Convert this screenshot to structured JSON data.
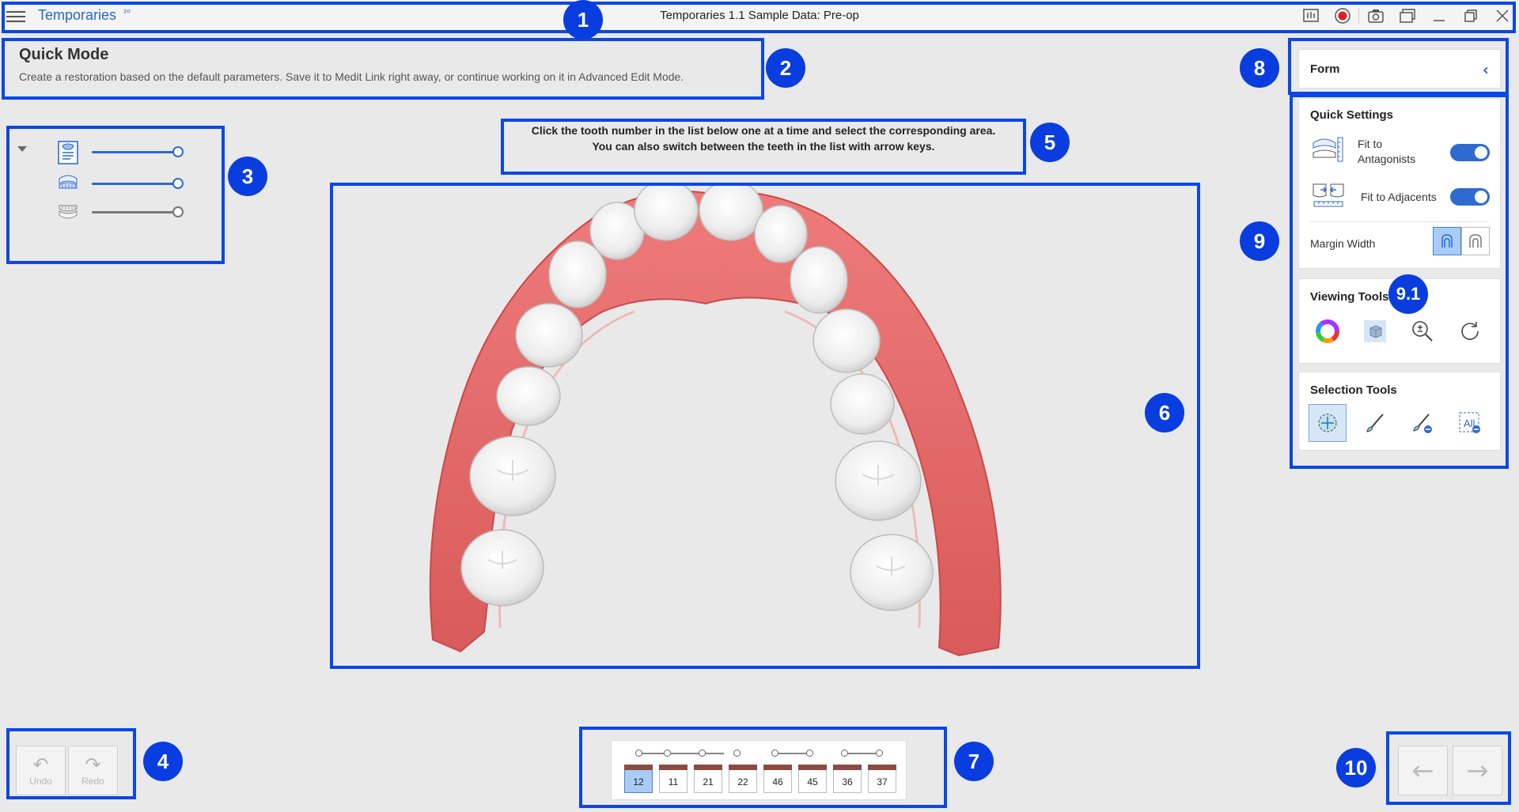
{
  "titlebar": {
    "app_name": "Temporaries",
    "app_name_mark": "²⁰",
    "window_title": "Temporaries 1.1 Sample Data: Pre-op"
  },
  "header": {
    "title": "Quick Mode",
    "description": "Create a restoration based on the default parameters. Save it to Medit Link right away, or continue working on it in Advanced Edit Mode."
  },
  "data_tree": {
    "items": [
      {
        "name": "restoration-data",
        "opacity_pct": 100
      },
      {
        "name": "upper-scan",
        "opacity_pct": 100
      },
      {
        "name": "lower-scan",
        "opacity_pct": 100
      }
    ]
  },
  "instruction": {
    "line1": "Click the tooth number in the list below one at a time and select the corresponding area.",
    "line2": "You can also switch between the teeth in the list with arrow keys."
  },
  "history": {
    "undo_label": "Undo",
    "redo_label": "Redo"
  },
  "tooth_list": {
    "teeth": [
      "12",
      "11",
      "21",
      "22",
      "46",
      "45",
      "36",
      "37"
    ],
    "selected": "12"
  },
  "form_panel": {
    "title": "Form",
    "collapse_icon": "chevron-left-icon"
  },
  "quick_settings": {
    "title": "Quick Settings",
    "fit_antagonists_label": "Fit to Antagonists",
    "fit_antagonists_on": true,
    "fit_adjacents_label": "Fit to Adjacents",
    "fit_adjacents_on": true,
    "margin_width_label": "Margin Width"
  },
  "viewing_tools": {
    "title": "Viewing Tools",
    "tools": [
      "color-wheel-icon",
      "3d-cube-icon",
      "zoom-icon",
      "reset-view-icon"
    ]
  },
  "selection_tools": {
    "title": "Selection Tools",
    "tools": [
      "smart-selection-icon",
      "brush-icon",
      "erase-brush-icon",
      "deselect-all-icon"
    ],
    "all_label": "All"
  },
  "annotations": {
    "badges": [
      "1",
      "2",
      "3",
      "4",
      "5",
      "6",
      "7",
      "8",
      "9",
      "9.1",
      "10"
    ]
  },
  "colors": {
    "accent": "#2f6ad0",
    "highlight": "#0a47e8",
    "badge": "#0a3de0",
    "gum": "#e56d6d",
    "tooth": "#f2f2f2"
  }
}
